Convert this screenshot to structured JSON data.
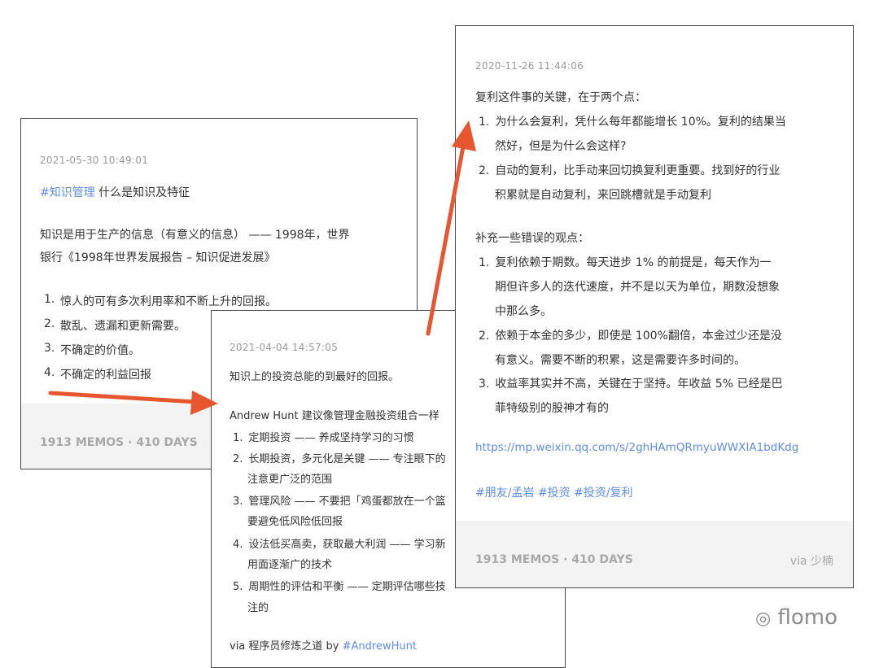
{
  "card1": {
    "date": "2021-05-30 10:49:01",
    "tag": "#知识管理",
    "title": " 什么是知识及特征",
    "para_line1": "知识是用于生产的信息（有意义的信息） —— 1998年，世界",
    "para_line2": "银行《1998年世界发展报告 – 知识促进发展》",
    "items": [
      "惊人的可有多次利用率和不断上升的回报。",
      "散乱、遗漏和更新需要。",
      "不确定的价值。",
      "不确定的利益回报"
    ],
    "footer_stats": "1913 MEMOS · 410 DAYS"
  },
  "card2": {
    "date": "2021-04-04 14:57:05",
    "line1": "知识上的投资总能的到最好的回报。",
    "line2": "Andrew Hunt 建议像管理金融投资组合一样",
    "items": [
      [
        "定期投资 —— 养成坚持学习的习惯"
      ],
      [
        "长期投资，多元化是关键 —— 专注眼下的",
        "注意更广泛的范围"
      ],
      [
        "管理风险 —— 不要把「鸡蛋都放在一个篮",
        "要避免低风险低回报"
      ],
      [
        "设法低买高卖，获取最大利润 —— 学习新",
        "用面逐渐广的技术"
      ],
      [
        "周期性的评估和平衡 —— 定期评估哪些技",
        "注的"
      ]
    ],
    "via_prefix": "via 程序员修炼之道 by ",
    "via_tag": "#AndrewHunt"
  },
  "card3": {
    "date": "2020-11-26 11:44:06",
    "heading1": "复利这件事的关键，在于两个点：",
    "list1": [
      [
        "为什么会复利，凭什么每年都能增长 10%。复利的结果当",
        "然好，但是为什么会这样?"
      ],
      [
        "自动的复利，比手动来回切换复利更重要。找到好的行业",
        "积累就是自动复利，来回跳槽就是手动复利"
      ]
    ],
    "heading2": "补充一些错误的观点：",
    "list2": [
      [
        "复利依赖于期数。每天进步 1% 的前提是，每天作为一",
        "期但许多人的迭代速度，并不是以天为单位，期数没想象",
        "中那么多。"
      ],
      [
        "依赖于本金的多少，即使是 100%翻倍，本金过少还是没",
        "有意义。需要不断的积累，这是需要许多时间的。"
      ],
      [
        "收益率其实并不高，关键在于坚持。年收益 5% 已经是巴",
        "菲特级别的股神才有的"
      ]
    ],
    "link": "https://mp.weixin.qq.com/s/2ghHAmQRmyuWWXIA1bdKdg",
    "tags": "#朋友/孟岩 #投资 #投资/复利",
    "footer_stats": "1913 MEMOS · 410 DAYS",
    "footer_via": "via 少楠"
  },
  "watermark": "flomo",
  "colors": {
    "arrow": "#e8562f",
    "tag": "#5b8ef0",
    "footer_bg": "#f3f3f3"
  }
}
